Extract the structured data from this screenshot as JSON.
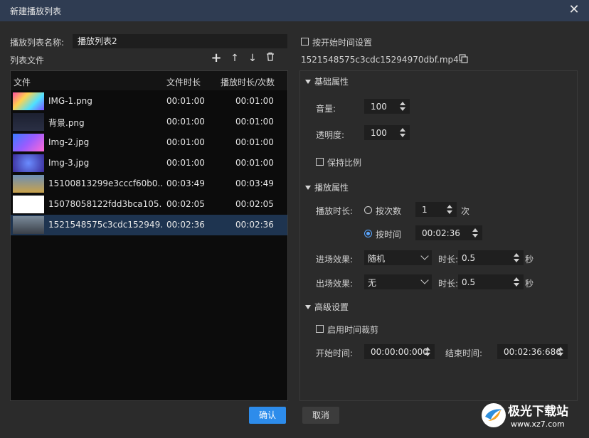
{
  "window": {
    "title": "新建播放列表",
    "close_icon": "close-icon"
  },
  "left": {
    "name_label": "播放列表名称:",
    "name_value": "播放列表2",
    "files_label": "列表文件",
    "toolbar": {
      "add": "+",
      "up": "↑",
      "down": "↓",
      "delete": "🗑"
    },
    "columns": {
      "file": "文件",
      "duration": "文件时长",
      "play": "播放时长/次数"
    },
    "rows": [
      {
        "name": "IMG-1.png",
        "duration": "00:01:00",
        "play": "00:01:00"
      },
      {
        "name": "背景.png",
        "duration": "00:01:00",
        "play": "00:01:00"
      },
      {
        "name": "Img-2.jpg",
        "duration": "00:01:00",
        "play": "00:01:00"
      },
      {
        "name": "Img-3.jpg",
        "duration": "00:01:00",
        "play": "00:01:00"
      },
      {
        "name": "15100813299e3cccf60b0...",
        "duration": "00:03:49",
        "play": "00:03:49"
      },
      {
        "name": "15078058122fdd3bca105...",
        "duration": "00:02:05",
        "play": "00:02:05"
      },
      {
        "name": "1521548575c3cdc152949...",
        "duration": "00:02:36",
        "play": "00:02:36"
      }
    ],
    "selected_row": 6
  },
  "right": {
    "start_time_setting": "按开始时间设置",
    "file_path": "1521548575c3cdc15294970dbf.mp4...",
    "basic": {
      "title": "基础属性",
      "volume_label": "音量:",
      "volume": "100",
      "opacity_label": "透明度:",
      "opacity": "100",
      "keep_ratio": "保持比例"
    },
    "play": {
      "title": "播放属性",
      "duration_label": "播放时长:",
      "by_count": "按次数",
      "count": "1",
      "count_unit": "次",
      "by_time": "按时间",
      "time": "00:02:36",
      "enter_label": "进场效果:",
      "enter_value": "随机",
      "enter_len_label": "时长:",
      "enter_len": "0.5",
      "exit_label": "出场效果:",
      "exit_value": "无",
      "exit_len_label": "时长:",
      "exit_len": "0.5",
      "sec_unit": "秒"
    },
    "advanced": {
      "title": "高级设置",
      "enable_crop": "启用时间裁剪",
      "start_label": "开始时间:",
      "start": "00:00:00:000",
      "end_label": "结束时间:",
      "end": "00:02:36:686"
    }
  },
  "buttons": {
    "ok": "确认",
    "cancel": "取消"
  },
  "watermark": {
    "text": "极光下载站",
    "url": "www.xz7.com"
  },
  "colors": {
    "accent": "#2d8ceb",
    "selected_row": "#1e3450",
    "titlebar": "#2f3c52"
  }
}
